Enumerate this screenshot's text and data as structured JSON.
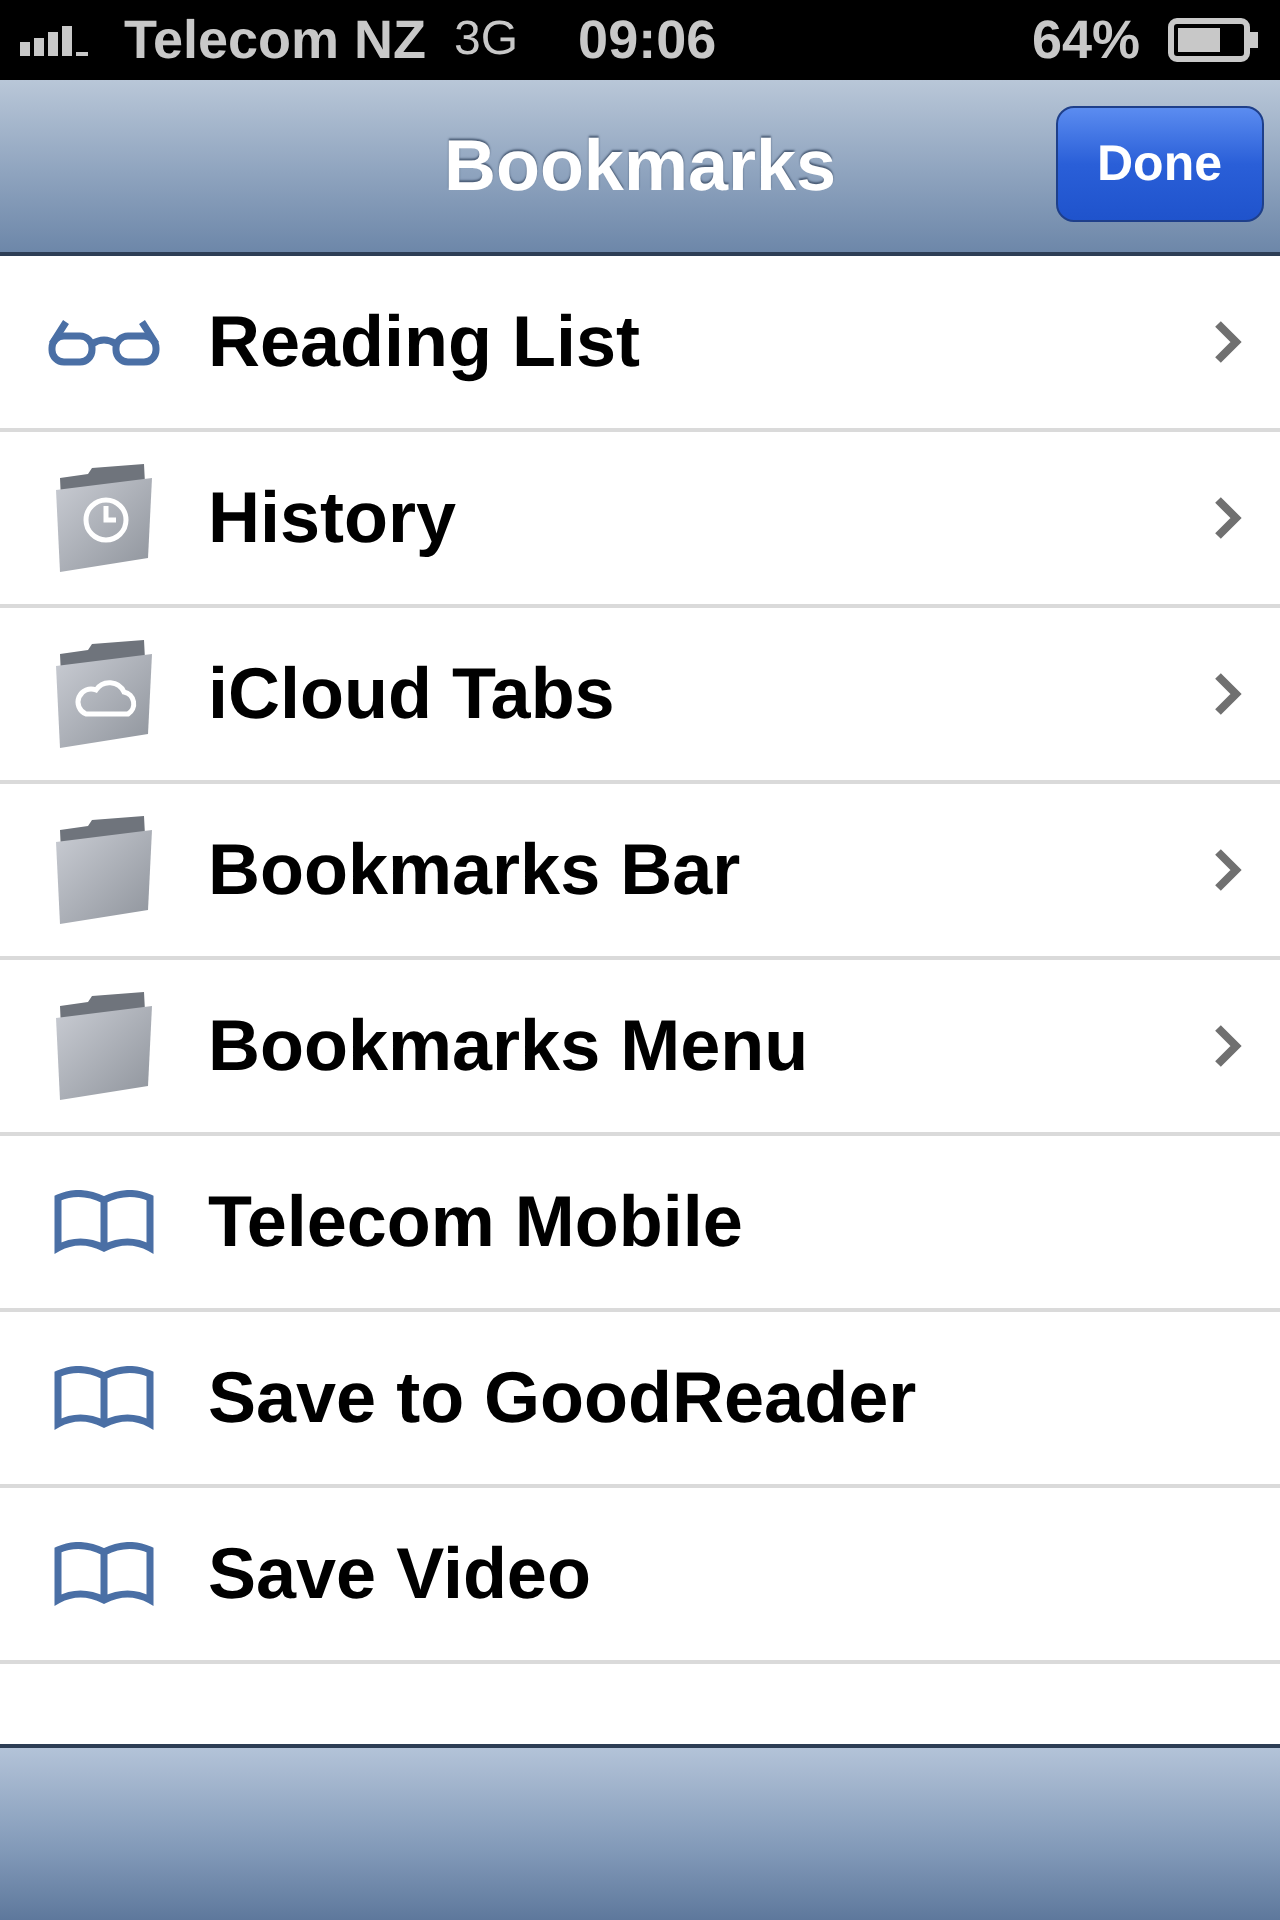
{
  "status_bar": {
    "carrier": "Telecom NZ",
    "network": "3G",
    "time": "09:06",
    "battery": "64%"
  },
  "nav_bar": {
    "title": "Bookmarks",
    "button": "Done"
  },
  "items": [
    {
      "kind": "glasses",
      "label": "Reading List",
      "disclosure": true
    },
    {
      "kind": "folder-clock",
      "label": "History",
      "disclosure": true
    },
    {
      "kind": "folder-cloud",
      "label": "iCloud Tabs",
      "disclosure": true
    },
    {
      "kind": "folder",
      "label": "Bookmarks Bar",
      "disclosure": true
    },
    {
      "kind": "folder",
      "label": "Bookmarks Menu",
      "disclosure": true
    },
    {
      "kind": "bookmark",
      "label": "Telecom Mobile",
      "disclosure": false
    },
    {
      "kind": "bookmark",
      "label": "Save to GoodReader",
      "disclosure": false
    },
    {
      "kind": "bookmark",
      "label": "Save Video",
      "disclosure": false
    }
  ]
}
